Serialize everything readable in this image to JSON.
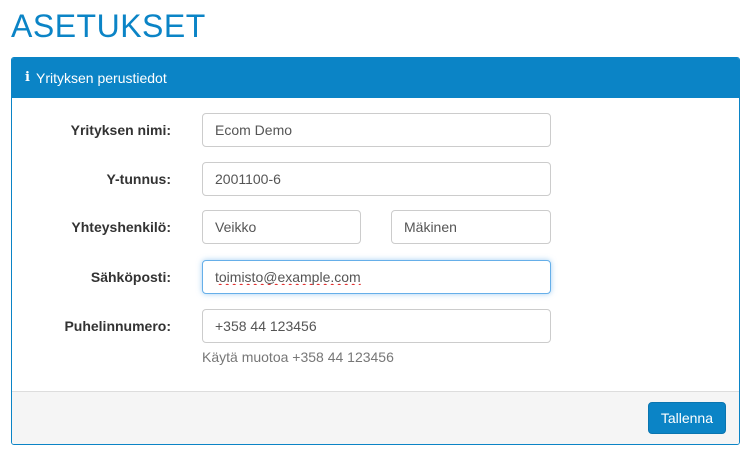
{
  "page": {
    "title": "ASETUKSET"
  },
  "panel": {
    "heading": "Yrityksen perustiedot",
    "heading_icon": "info-icon"
  },
  "form": {
    "company_name": {
      "label": "Yrityksen nimi:",
      "value": "Ecom Demo"
    },
    "business_id": {
      "label": "Y-tunnus:",
      "value": "2001100-6"
    },
    "contact_person": {
      "label": "Yhteyshenkilö:",
      "first_name": "Veikko",
      "last_name": "Mäkinen"
    },
    "email": {
      "label": "Sähköposti:",
      "value": "toimisto@example.com"
    },
    "phone": {
      "label": "Puhelinnumero:",
      "value": "+358 44 123456",
      "help": "Käytä muotoa +358 44 123456"
    }
  },
  "footer": {
    "save_label": "Tallenna"
  },
  "colors": {
    "accent": "#0b84c6",
    "focus": "#66afe9"
  }
}
